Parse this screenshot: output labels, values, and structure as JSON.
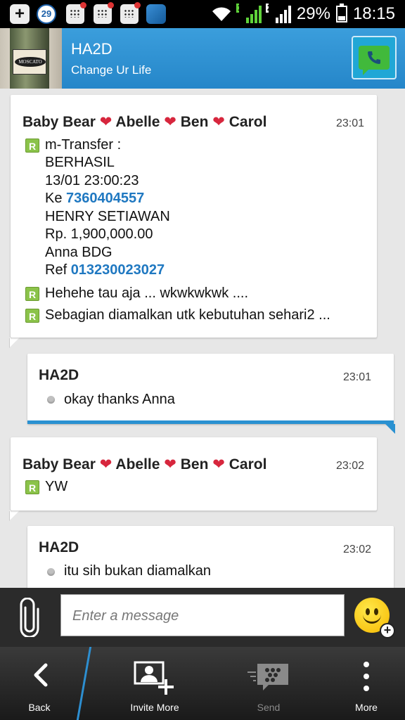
{
  "status_bar": {
    "notification_count": "29",
    "sim1": "1",
    "sim2": "2",
    "battery": "29%",
    "time": "18:15"
  },
  "header": {
    "title": "HA2D",
    "subtitle": "Change Ur Life",
    "avatar_label": "MOSCATO"
  },
  "messages": [
    {
      "sender": "Baby Bear ❤ Abelle ❤ Ben ❤ Carol",
      "sender_parts": [
        "Baby Bear",
        "Abelle",
        "Ben",
        "Carol"
      ],
      "time": "23:01",
      "lines": {
        "l1": "m-Transfer :",
        "l2": "BERHASIL",
        "l3": "13/01 23:00:23",
        "l4_prefix": "Ke ",
        "l4_link": "7360404557",
        "l5": "HENRY SETIAWAN",
        "l6": "Rp. 1,900,000.00",
        "l7": "Anna BDG",
        "l8_prefix": "Ref ",
        "l8_link": "013230023027",
        "l9": "Hehehe tau aja ... wkwkwkwk ....",
        "l10": "Sebagian diamalkan utk kebutuhan sehari2 ..."
      }
    },
    {
      "sender": "HA2D",
      "time": "23:01",
      "text": "okay thanks Anna"
    },
    {
      "sender_parts": [
        "Baby Bear",
        "Abelle",
        "Ben",
        "Carol"
      ],
      "time": "23:02",
      "text": "YW"
    },
    {
      "sender": "HA2D",
      "time": "23:02",
      "text": "itu sih bukan diamalkan"
    }
  ],
  "composer": {
    "placeholder": "Enter a message"
  },
  "actions": {
    "back": "Back",
    "invite": "Invite More",
    "send": "Send",
    "more": "More"
  },
  "colors": {
    "header": "#2586c9",
    "link": "#1f78c1",
    "r_badge": "#8bc34a",
    "heart": "#d7263d"
  }
}
